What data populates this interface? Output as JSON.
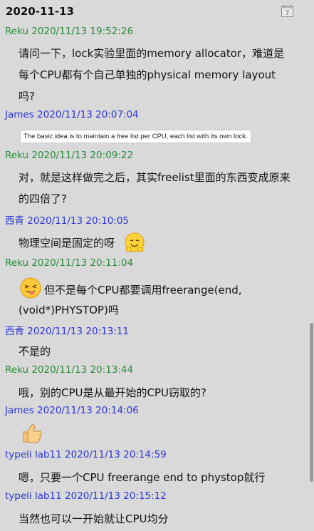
{
  "chat": {
    "date": "2020-11-13",
    "messages": [
      {
        "sender": "Reku 2020/11/13 19:52:26",
        "lines": [
          "请问一下，lock实验里面的memory allocator，难道是",
          "每个CPU都有个自己单独的physical memory layout",
          "吗?"
        ]
      },
      {
        "sender": "James 2020/11/13 20:07:04",
        "quote": "The basic idea is to maintain a free list per CPU, each list with its own lock."
      },
      {
        "sender": "Reku 2020/11/13 20:09:22",
        "lines": [
          "对，就是这样做完之后，其实freelist里面的东西变成原来",
          "的四倍了?"
        ]
      },
      {
        "sender": "西青 2020/11/13 20:10:05",
        "lines": [
          "物理空间是固定的呀"
        ]
      },
      {
        "sender": "Reku 2020/11/13 20:11:04",
        "lines": [
          "但不是每个CPU都要调用freerange(end,",
          "(void*)PHYSTOP)吗"
        ]
      },
      {
        "sender": "西青 2020/11/13 20:13:11",
        "lines": [
          "不是的"
        ]
      },
      {
        "sender": "Reku 2020/11/13 20:13:44",
        "lines": [
          "哦，别的CPU是从最开始的CPU窃取的?"
        ]
      },
      {
        "sender": "James 2020/11/13 20:14:06"
      },
      {
        "sender": "typeli lab11 2020/11/13 20:14:59",
        "lines": [
          "嗯，只要一个CPU freerange end to phystop就行"
        ]
      },
      {
        "sender": "typeli lab11 2020/11/13 20:15:12",
        "lines": [
          "当然也可以一开始就让CPU均分"
        ]
      }
    ]
  },
  "icons": {
    "calendar": "calendar-icon",
    "emoji_smile": "smiling-face-emoji",
    "emoji_tongue": "squinting-tongue-emoji",
    "emoji_thumbs": "thumbs-up-emoji"
  },
  "colors": {
    "background": "#d9d9d9",
    "sender_green": "#2a8a3a",
    "sender_blue": "#2b35d9",
    "text": "#111111",
    "scrollbar_thumb": "#9a9a9a"
  }
}
